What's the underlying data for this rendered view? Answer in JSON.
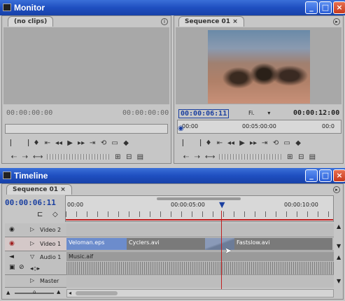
{
  "monitor": {
    "window_title": "Monitor",
    "source_tab": "(no clips)",
    "program_tab": "Sequence 01",
    "program_tab_close": "×",
    "source_in": "00:00:00:00",
    "source_out": "00:00:00:00",
    "program_current": "00:00:06:11",
    "program_fit": "Fi.",
    "program_duration": "00:00:12:00",
    "program_ruler_start": "00:00",
    "program_ruler_mid": "00:05:00:00",
    "program_ruler_end": "00:0"
  },
  "timeline": {
    "window_title": "Timeline",
    "sequence_tab": "Sequence 01",
    "sequence_tab_close": "×",
    "current_time": "00:00:06:11",
    "ruler_start": "00:00",
    "ruler_mid": "00:00:05:00",
    "ruler_end": "00:00:10:00",
    "tracks": {
      "video2": "Video 2",
      "video1": "Video 1",
      "audio1": "Audio 1",
      "master": "Master"
    },
    "clips": {
      "velo": "Veloman.eps",
      "cyclers": "Cyclers.avi",
      "fastslow": "Fastslow.avi",
      "music": "Music.aif"
    }
  },
  "colors": {
    "titlebar": "#1f4fc0",
    "clip_video_blue": "#6c8ccc",
    "clip_video_gray": "#7a7a7a",
    "clip_audio": "#9a9a9a",
    "playhead": "#c02020",
    "active_timecode": "#1a3fa0"
  }
}
